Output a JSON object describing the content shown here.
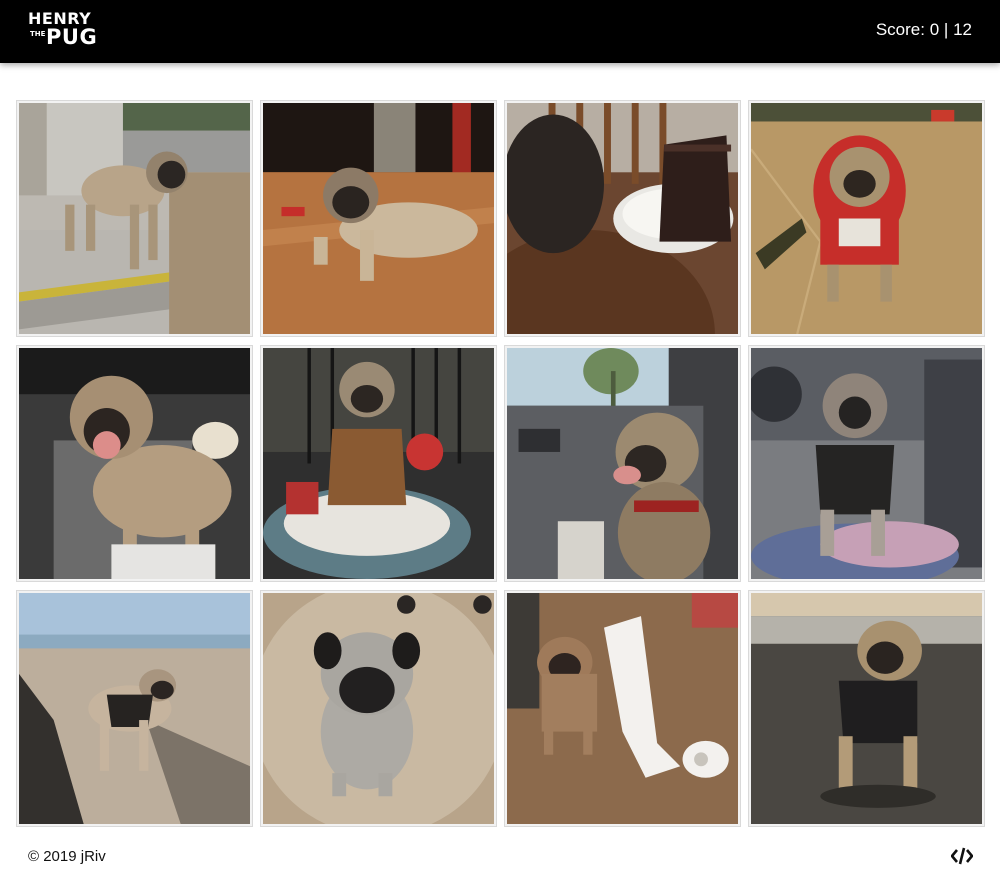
{
  "header": {
    "logo": {
      "line1": "HENRY",
      "line2_small": "THE",
      "line2": "PUG"
    },
    "score": {
      "label": "Score:",
      "current": "0",
      "separator": "|",
      "total": "12"
    }
  },
  "grid": {
    "cards": [
      {
        "icon": "pug-standing-curb-photo"
      },
      {
        "icon": "pug-lying-wood-floor-photo"
      },
      {
        "icon": "pug-cake-plate-photo"
      },
      {
        "icon": "pug-red-hoodie-photo"
      },
      {
        "icon": "pug-car-seat-open-mouth-photo"
      },
      {
        "icon": "pug-costume-bed-photo"
      },
      {
        "icon": "pug-car-window-red-collar-photo"
      },
      {
        "icon": "pug-car-seat-harness-photo"
      },
      {
        "icon": "pug-beach-photo"
      },
      {
        "icon": "pug-looking-up-photo"
      },
      {
        "icon": "pug-toilet-paper-photo"
      },
      {
        "icon": "pug-street-harness-photo"
      }
    ]
  },
  "footer": {
    "copyright": "© 2019 jRiv",
    "code_icon": "code-icon"
  },
  "colors": {
    "header_bg": "#000000",
    "text_light": "#ffffff",
    "text_dark": "#111111"
  }
}
